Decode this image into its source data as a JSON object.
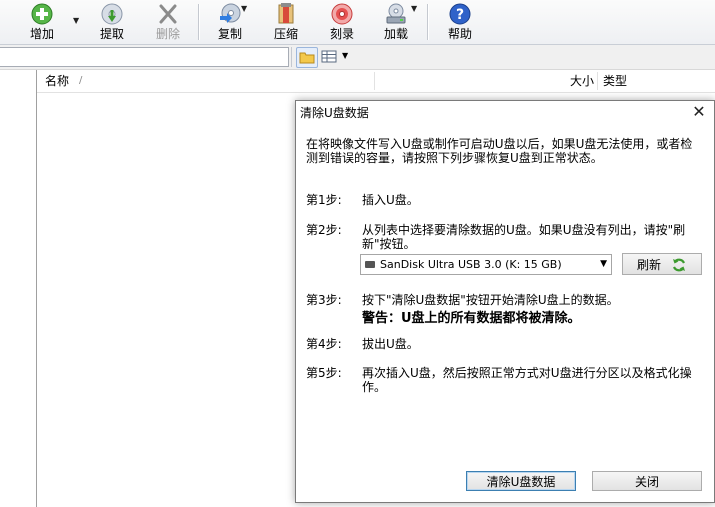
{
  "toolbar": {
    "add": "增加",
    "extract": "提取",
    "delete": "删除",
    "copy": "复制",
    "compress": "压缩",
    "burn": "刻录",
    "mount": "加载",
    "help": "帮助"
  },
  "list": {
    "col_name": "名称",
    "col_name_sort": "/",
    "col_size": "大小",
    "col_type": "类型"
  },
  "dialog": {
    "title": "清除U盘数据",
    "intro": "在将映像文件写入U盘或制作可启动U盘以后，如果U盘无法使用，或者检测到错误的容量，请按照下列步骤恢复U盘到正常状态。",
    "steps": [
      {
        "label": "第1步:",
        "text": "插入U盘。"
      },
      {
        "label": "第2步:",
        "text": "从列表中选择要清除数据的U盘。如果U盘没有列出，请按\"刷新\"按钮。"
      },
      {
        "label": "第3步:",
        "text": "按下\"清除U盘数据\"按钮开始清除U盘上的数据。"
      },
      {
        "label": "第4步:",
        "text": "拔出U盘。"
      },
      {
        "label": "第5步:",
        "text": "再次插入U盘，然后按照正常方式对U盘进行分区以及格式化操作。"
      }
    ],
    "warning": "警告：U盘上的所有数据都将被清除。",
    "drive_selected": "SanDisk Ultra USB 3.0 (K: 15 GB)",
    "refresh_label": "刷新",
    "clear_button": "清除U盘数据",
    "close_button": "关闭"
  },
  "icons": {
    "add": "plus-green-icon",
    "extract": "extract-icon",
    "delete": "delete-x-icon",
    "copy": "copy-disc-icon",
    "compress": "compress-icon",
    "burn": "burn-disc-icon",
    "mount": "mount-drive-icon",
    "help": "help-question-icon"
  },
  "colors": {
    "accent_blue": "#1f5fb8",
    "green": "#3c9a2e",
    "default_button_border": "#3c7fb1"
  }
}
